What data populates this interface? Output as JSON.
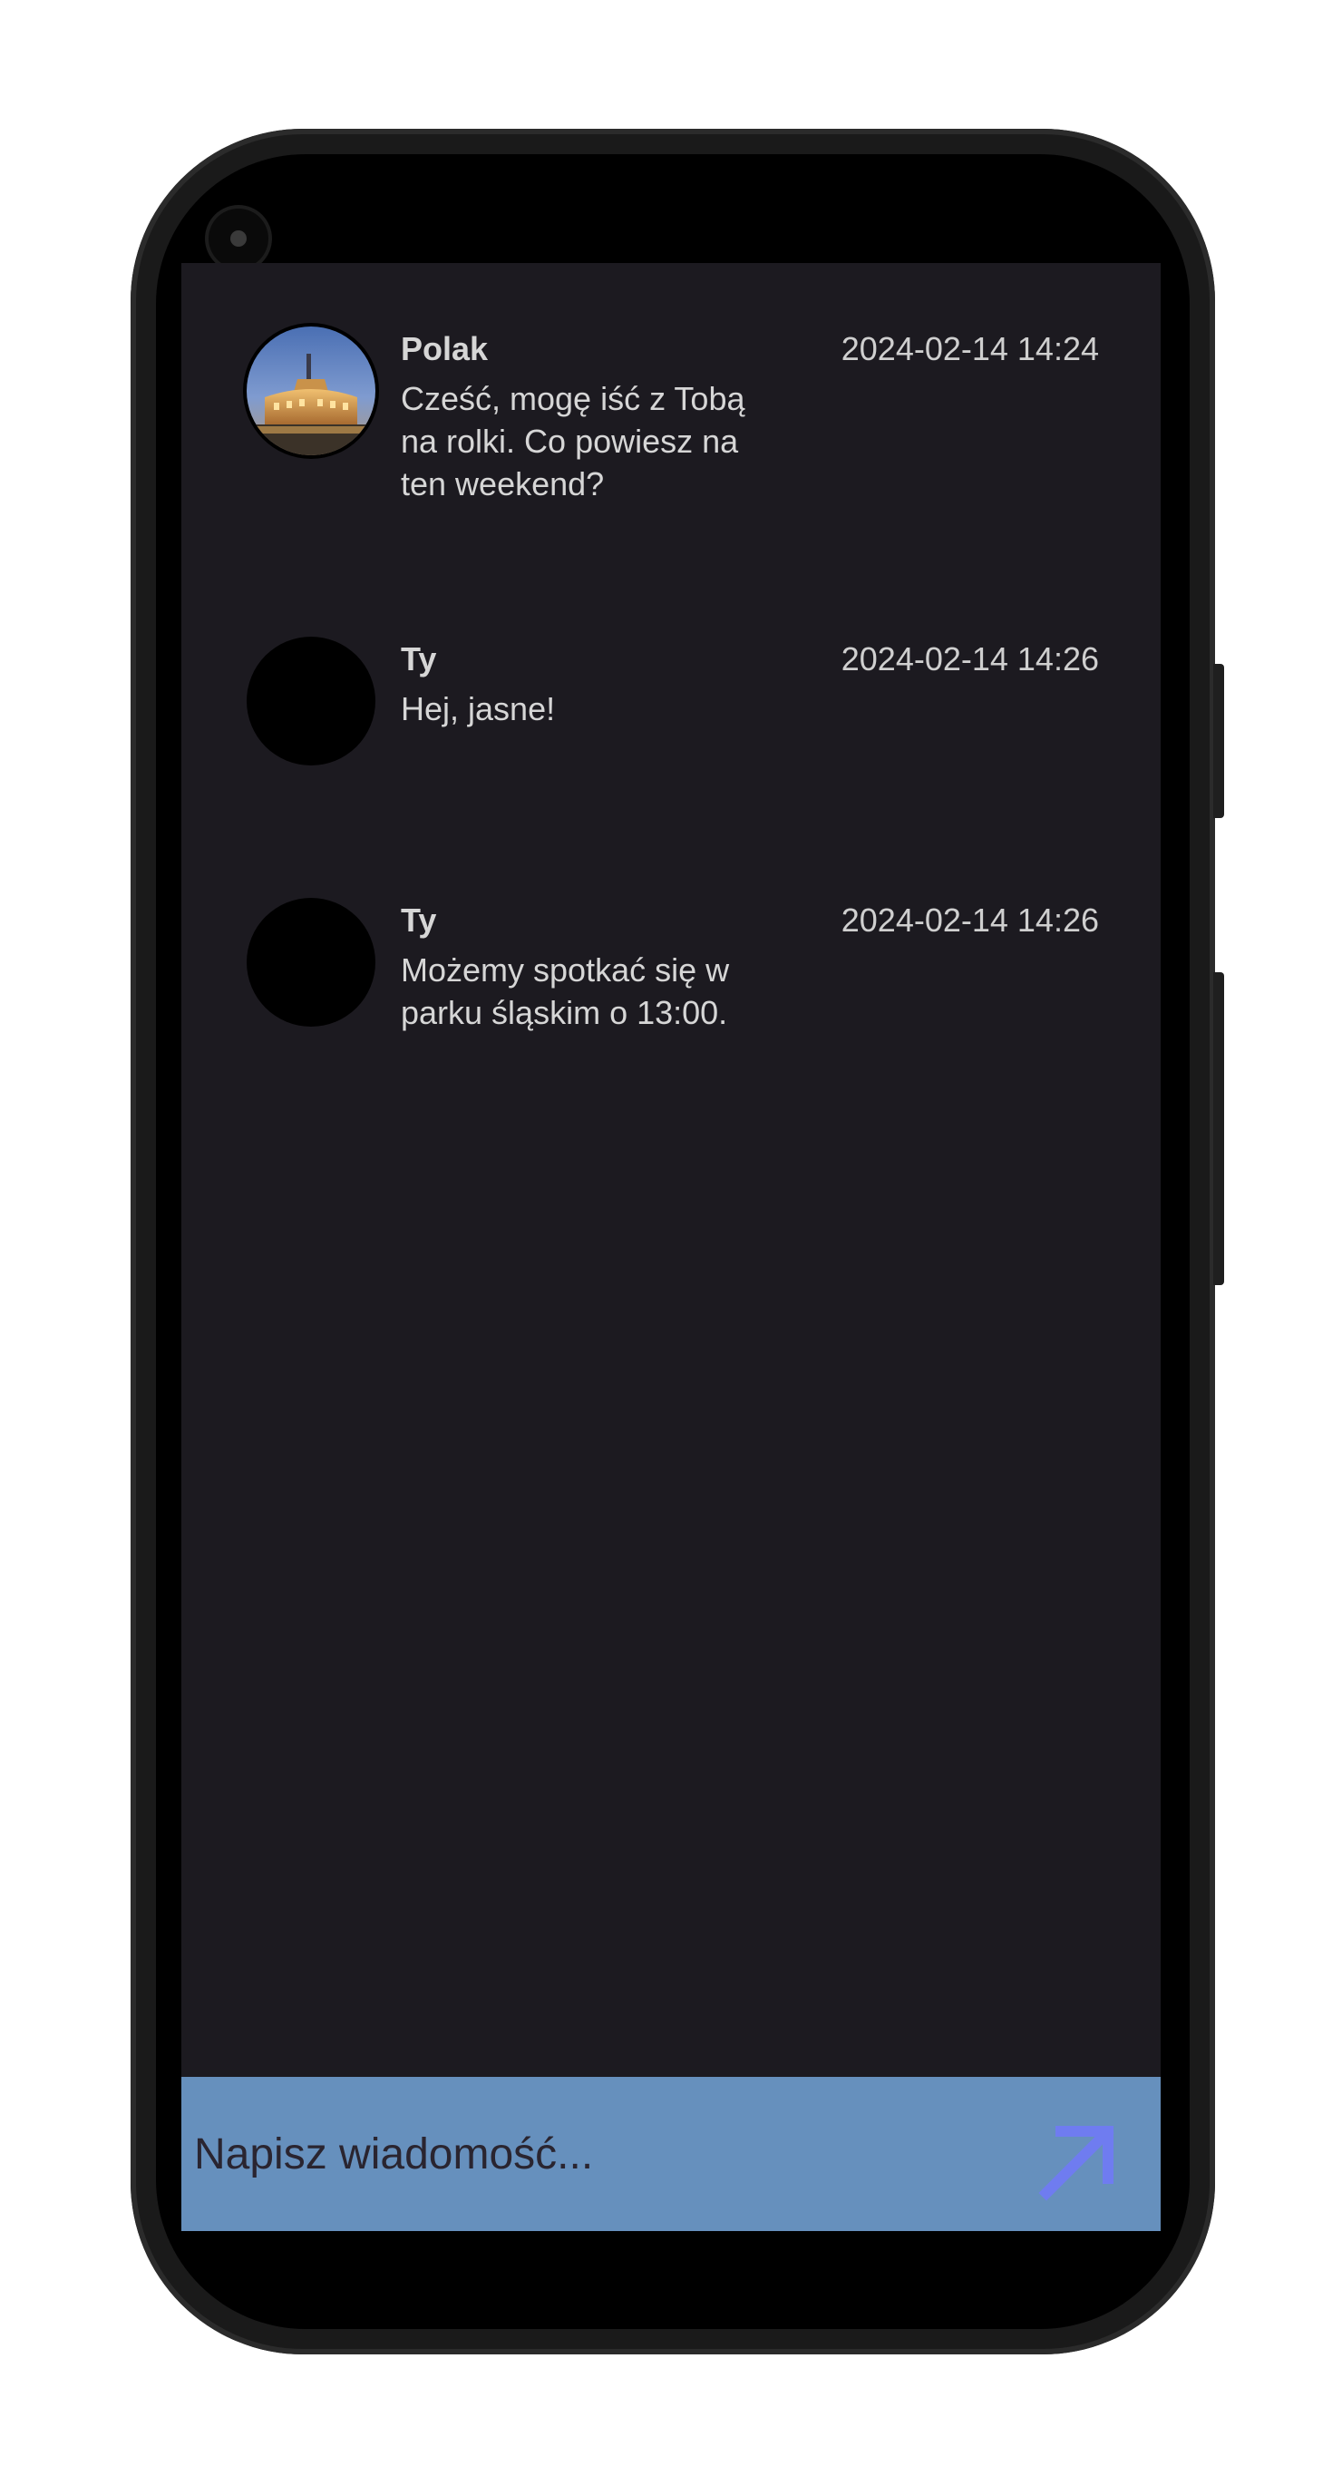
{
  "messages": [
    {
      "sender": "Polak",
      "time": "2024-02-14 14:24",
      "text": "Cześć, mogę iść z Tobą na rolki. Co powiesz na ten weekend?",
      "avatar": "photo-castle"
    },
    {
      "sender": "Ty",
      "time": "2024-02-14 14:26",
      "text": "Hej, jasne!",
      "avatar": "empty"
    },
    {
      "sender": "Ty",
      "time": "2024-02-14 14:26",
      "text": "Możemy spotkać się w parku śląskim o 13:00.",
      "avatar": "empty"
    }
  ],
  "composer": {
    "placeholder": "Napisz wiadomość...",
    "value": "",
    "send_icon": "arrow-up-right-icon"
  },
  "colors": {
    "chat_background": "#1c1a20",
    "composer_background": "#6690bd",
    "send_icon": "#6f7cf0",
    "text": "#d6d6d6"
  }
}
